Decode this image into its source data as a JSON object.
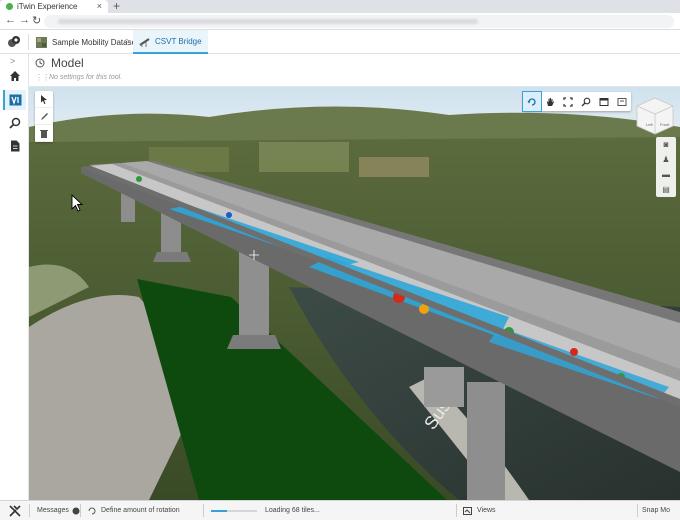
{
  "browser": {
    "tab_title": "iTwin Experience",
    "tab_close": "×",
    "new_tab": "+",
    "back": "←",
    "forward": "→",
    "reload": "↻"
  },
  "header": {
    "breadcrumbs": [
      {
        "label": "Sample Mobility Dataset",
        "icon": "dataset-thumbnail-icon"
      },
      {
        "label": "CSVT Bridge",
        "icon": "bridge-icon"
      }
    ],
    "separator": ">"
  },
  "sidebar": {
    "expand": ">",
    "items": [
      {
        "name": "home",
        "icon": "home-icon"
      },
      {
        "name": "model",
        "icon": "model-icon",
        "active": true
      },
      {
        "name": "search",
        "icon": "search-icon"
      },
      {
        "name": "documents",
        "icon": "document-icon"
      }
    ]
  },
  "panel": {
    "title": "Model",
    "note": "No settings for this tool."
  },
  "navcube": {
    "faces": [
      "Left",
      "Front"
    ]
  },
  "statusbar": {
    "messages": "Messages",
    "prompt": "Define amount of rotation",
    "loading": "Loading 68 tiles...",
    "load_progress": 0.35,
    "views": "Views",
    "snap": "Snap Mo"
  },
  "scene": {
    "road_marking": "Sus",
    "accent_color": "#3aa0d8",
    "deck_color": "#8a8a8a",
    "pier_color": "#9a9a9a"
  }
}
